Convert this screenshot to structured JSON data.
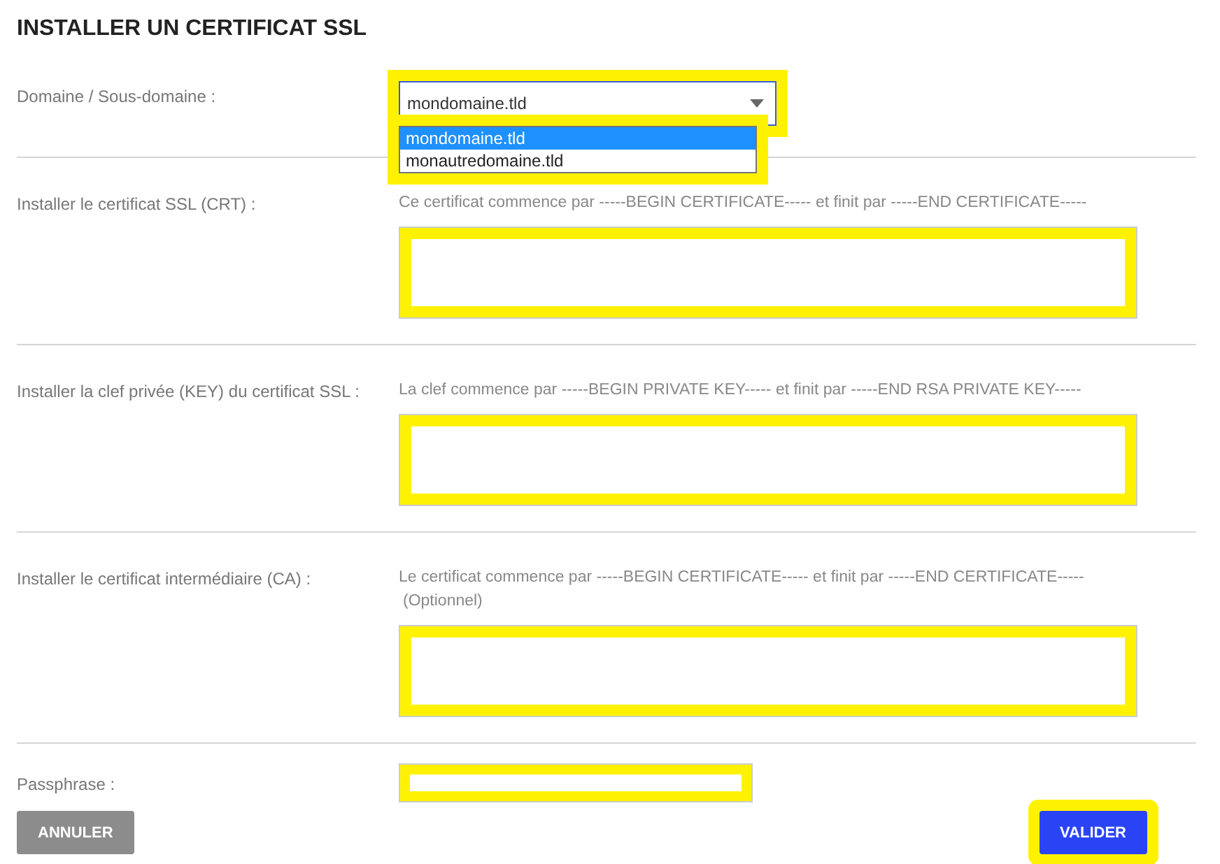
{
  "title": "INSTALLER UN CERTIFICAT SSL",
  "domain": {
    "label": "Domaine / Sous-domaine :",
    "value": "mondomaine.tld",
    "highlighted": true,
    "expanded": true,
    "options": [
      {
        "label": "mondomaine.tld",
        "selected": true
      },
      {
        "label": "monautredomaine.tld",
        "selected": false
      }
    ]
  },
  "fields": [
    {
      "label": "Installer le certificat SSL (CRT) :",
      "hint": "Ce certificat commence par -----BEGIN CERTIFICATE----- et finit par -----END CERTIFICATE-----",
      "highlighted": true
    },
    {
      "label": "Installer la clef privée (KEY) du certificat SSL :",
      "hint": "La clef commence par -----BEGIN PRIVATE KEY----- et finit par -----END RSA PRIVATE KEY-----",
      "highlighted": true
    },
    {
      "label": "Installer le certificat intermédiaire (CA) :",
      "hint": "Le certificat commence par -----BEGIN CERTIFICATE----- et finit par -----END CERTIFICATE-----",
      "note": "(Optionnel)",
      "highlighted": true
    }
  ],
  "passphrase": {
    "label": "Passphrase :",
    "highlighted": true
  },
  "buttons": [
    {
      "label": "ANNULER",
      "kind": "secondary",
      "highlighted": false
    },
    {
      "label": "VALIDER",
      "kind": "primary",
      "highlighted": true
    }
  ]
}
